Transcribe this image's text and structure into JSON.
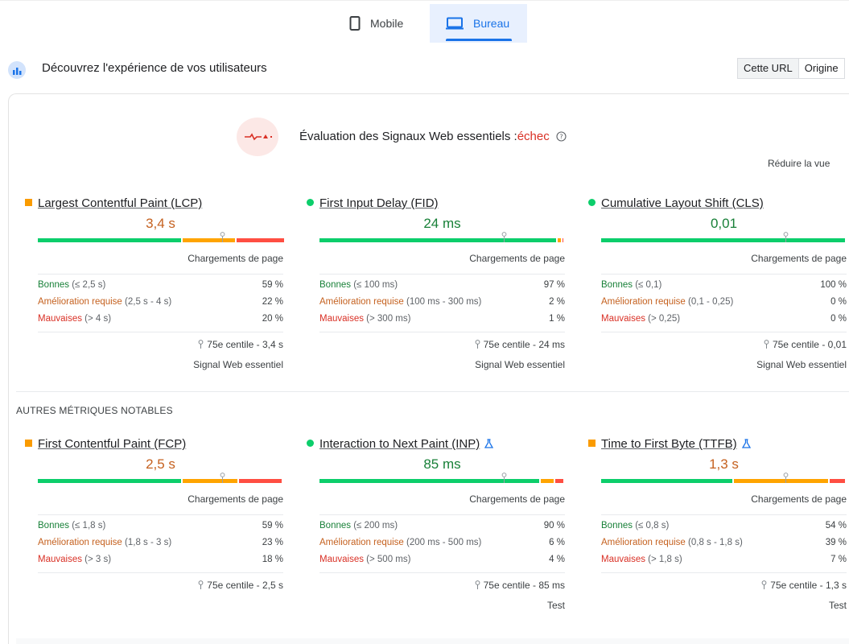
{
  "tabs": {
    "mobile": "Mobile",
    "bureau": "Bureau"
  },
  "header": {
    "title": "Découvrez l'expérience de vos utilisateurs",
    "toggle_active": "Cette URL",
    "toggle_other": "Origine"
  },
  "assessment": {
    "title": "Évaluation des Signaux Web essentiels :",
    "status": "échec",
    "reduce": "Réduire la vue"
  },
  "section_other": "AUTRES MÉTRIQUES NOTABLES",
  "colors": {
    "good": "#0cce6b",
    "ni": "#ffa400",
    "poor": "#ff4e42",
    "accent": "#1a73e8"
  },
  "metrics": [
    {
      "name": "Largest Contentful Paint (LCP)",
      "indicator": "square",
      "value": "3,4 s",
      "value_color": "#c5611f",
      "loads": "Chargements de page",
      "fractions": [
        0.59,
        0.22,
        0.2
      ],
      "marker": 0.75,
      "good_label": "Bonnes",
      "good_range": "(≤ 2,5 s)",
      "good_pct": "59 %",
      "ni_label": "Amélioration requise",
      "ni_range": "(2,5 s - 4 s)",
      "ni_pct": "22 %",
      "poor_label": "Mauvaises",
      "poor_range": "(> 4 s)",
      "poor_pct": "20 %",
      "percentile": "75e centile - 3,4 s",
      "footer": "Signal Web essentiel"
    },
    {
      "name": "First Input Delay (FID)",
      "indicator": "circle",
      "value": "24 ms",
      "value_color": "#188038",
      "loads": "Chargements de page",
      "fractions": [
        0.97,
        0.02,
        0.01
      ],
      "marker": 0.75,
      "good_label": "Bonnes",
      "good_range": "(≤ 100 ms)",
      "good_pct": "97 %",
      "ni_label": "Amélioration requise",
      "ni_range": "(100 ms - 300 ms)",
      "ni_pct": "2 %",
      "poor_label": "Mauvaises",
      "poor_range": "(> 300 ms)",
      "poor_pct": "1 %",
      "percentile": "75e centile - 24 ms",
      "footer": "Signal Web essentiel"
    },
    {
      "name": "Cumulative Layout Shift (CLS)",
      "indicator": "circle",
      "value": "0,01",
      "value_color": "#188038",
      "loads": "Chargements de page",
      "fractions": [
        1.0,
        0,
        0
      ],
      "marker": 0.75,
      "good_label": "Bonnes",
      "good_range": "(≤ 0,1)",
      "good_pct": "100 %",
      "ni_label": "Amélioration requise",
      "ni_range": "(0,1 - 0,25)",
      "ni_pct": "0 %",
      "poor_label": "Mauvaises",
      "poor_range": "(> 0,25)",
      "poor_pct": "0 %",
      "percentile": "75e centile - 0,01",
      "footer": "Signal Web essentiel"
    },
    {
      "name": "First Contentful Paint (FCP)",
      "indicator": "square",
      "value": "2,5 s",
      "value_color": "#c5611f",
      "loads": "Chargements de page",
      "fractions": [
        0.59,
        0.23,
        0.18
      ],
      "marker": 0.75,
      "good_label": "Bonnes",
      "good_range": "(≤ 1,8 s)",
      "good_pct": "59 %",
      "ni_label": "Amélioration requise",
      "ni_range": "(1,8 s - 3 s)",
      "ni_pct": "23 %",
      "poor_label": "Mauvaises",
      "poor_range": "(> 3 s)",
      "poor_pct": "18 %",
      "percentile": "75e centile - 2,5 s",
      "footer": ""
    },
    {
      "name": "Interaction to Next Paint (INP)",
      "indicator": "circle",
      "experimental": true,
      "value": "85 ms",
      "value_color": "#188038",
      "loads": "Chargements de page",
      "fractions": [
        0.9,
        0.06,
        0.04
      ],
      "marker": 0.75,
      "good_label": "Bonnes",
      "good_range": "(≤ 200 ms)",
      "good_pct": "90 %",
      "ni_label": "Amélioration requise",
      "ni_range": "(200 ms - 500 ms)",
      "ni_pct": "6 %",
      "poor_label": "Mauvaises",
      "poor_range": "(> 500 ms)",
      "poor_pct": "4 %",
      "percentile": "75e centile - 85 ms",
      "footer": "Test"
    },
    {
      "name": "Time to First Byte (TTFB)",
      "indicator": "square",
      "experimental": true,
      "value": "1,3 s",
      "value_color": "#c5611f",
      "loads": "Chargements de page",
      "fractions": [
        0.54,
        0.39,
        0.07
      ],
      "marker": 0.75,
      "good_label": "Bonnes",
      "good_range": "(≤ 0,8 s)",
      "good_pct": "54 %",
      "ni_label": "Amélioration requise",
      "ni_range": "(0,8 s - 1,8 s)",
      "ni_pct": "39 %",
      "poor_label": "Mauvaises",
      "poor_range": "(> 1,8 s)",
      "poor_pct": "7 %",
      "percentile": "75e centile - 1,3 s",
      "footer": "Test"
    }
  ]
}
